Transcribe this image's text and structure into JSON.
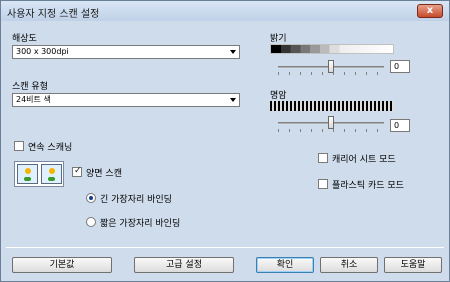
{
  "window": {
    "title": "사용자 지정 스캔 설정",
    "close_label": "x"
  },
  "resolution": {
    "label": "해상도",
    "value": "300 x 300dpi"
  },
  "scan_type": {
    "label": "스캔 유형",
    "value": "24비트 색"
  },
  "brightness": {
    "label": "밝기",
    "value": "0",
    "level": 0.5
  },
  "contrast": {
    "label": "명암",
    "value": "0",
    "level": 0.5
  },
  "continuous_scan": {
    "label": "연속 스캐닝",
    "checked": false
  },
  "duplex": {
    "label": "양면 스캔",
    "checked": true
  },
  "binding": {
    "long_edge": {
      "label": "긴 가장자리 바인딩",
      "selected": true
    },
    "short_edge": {
      "label": "짧은 가장자리 바인딩",
      "selected": false
    }
  },
  "carrier_sheet": {
    "label": "캐리어 시트 모드",
    "checked": false
  },
  "plastic_card": {
    "label": "플라스틱 카드 모드",
    "checked": false
  },
  "buttons": {
    "default": "기본값",
    "advanced": "고급 설정",
    "ok": "확인",
    "cancel": "취소",
    "help": "도움말"
  }
}
